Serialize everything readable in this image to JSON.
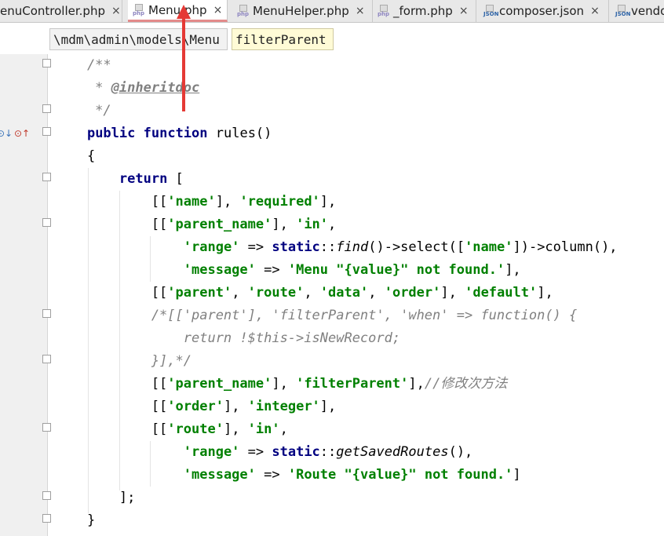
{
  "tabs": [
    {
      "label": "enuController.php",
      "icon": "php-file-icon",
      "active": false
    },
    {
      "label": "Menu.php",
      "icon": "php-file-icon",
      "active": true
    },
    {
      "label": "MenuHelper.php",
      "icon": "php-file-icon",
      "active": false
    },
    {
      "label": "_form.php",
      "icon": "php-file-icon",
      "active": false
    },
    {
      "label": "composer.json",
      "icon": "json-file-icon",
      "active": false
    },
    {
      "label": "vendo",
      "icon": "json-file-icon",
      "active": false
    }
  ],
  "icon_labels": {
    "php": "php",
    "json": "JSON"
  },
  "close_glyph": "×",
  "breadcrumb": {
    "namespace": "\\mdm\\admin\\models\\Menu",
    "method": "filterParent"
  },
  "code_lines": [
    "    /**",
    "     * @inheritdoc",
    "     */",
    "    public function rules()",
    "    {",
    "        return [",
    "            [['name'], 'required'],",
    "            [['parent_name'], 'in',",
    "                'range' => static::find()->select(['name'])->column(),",
    "                'message' => 'Menu \"{value}\" not found.'],",
    "            [['parent', 'route', 'data', 'order'], 'default'],",
    "            /*[['parent'], 'filterParent', 'when' => function() {",
    "                return !$this->isNewRecord;",
    "            }],*/",
    "            [['parent_name'], 'filterParent'],//修改次方法",
    "            [['order'], 'integer'],",
    "            [['route'], 'in',",
    "                'range' => static::getSavedRoutes(),",
    "                'message' => 'Route \"{value}\" not found.']",
    "        ];",
    "    }"
  ],
  "colors": {
    "keyword": "#000080",
    "string": "#008000",
    "comment": "#808080",
    "annotation_arrow": "#e53935",
    "active_tab_underline": "#e38b8b"
  }
}
